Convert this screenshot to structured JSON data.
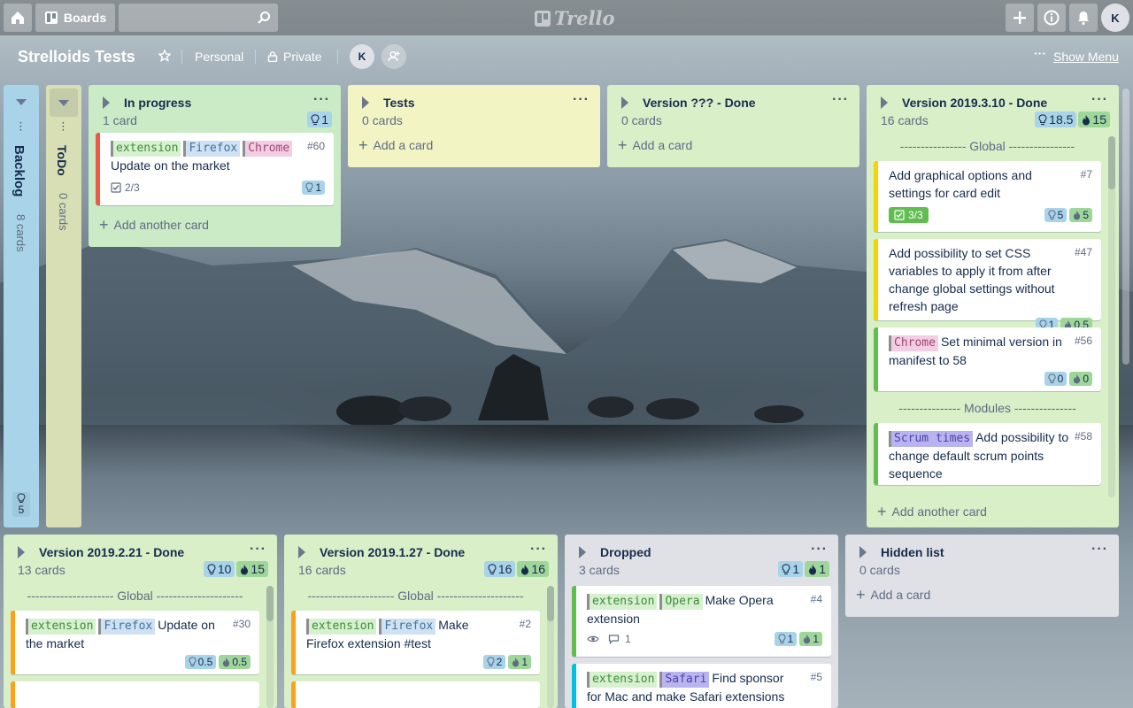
{
  "header": {
    "boards_label": "Boards",
    "logo_text": "Trello",
    "user_initial": "K"
  },
  "board": {
    "title": "Strelloids Tests",
    "team": "Personal",
    "visibility": "Private",
    "member_initial": "K",
    "show_menu": "Show Menu"
  },
  "collapsed": [
    {
      "title": "Backlog",
      "count": "8 cards",
      "points": "5"
    },
    {
      "title": "ToDo",
      "count": "0 cards"
    }
  ],
  "lists": {
    "in_progress": {
      "title": "In progress",
      "count": "1 card",
      "est": "1",
      "cards": [
        {
          "labels": [
            "extension",
            "Firefox",
            "Chrome"
          ],
          "text": "Update on the market",
          "num": "#60",
          "checklist": "2/3",
          "est": "1"
        }
      ],
      "add": "Add another card"
    },
    "tests": {
      "title": "Tests",
      "count": "0 cards",
      "add": "Add a card"
    },
    "version_unknown": {
      "title": "Version ??? - Done",
      "count": "0 cards",
      "add": "Add a card"
    },
    "v2019_3_10": {
      "title": "Version 2019.3.10 - Done",
      "count": "16 cards",
      "est": "18.5",
      "spent": "15",
      "sep_global": "Global",
      "sep_modules": "Modules",
      "cards": [
        {
          "text": "Add graphical options and settings for card edit",
          "num": "#7",
          "checklist": "3/3",
          "est": "5",
          "spent": "5"
        },
        {
          "text": "Add possibility to set CSS variables to apply it from after change global settings without refresh page",
          "num": "#47",
          "est": "1",
          "spent": "0.5"
        },
        {
          "labels": [
            "Chrome"
          ],
          "text": "Set minimal version in manifest to 58",
          "num": "#56",
          "est": "0",
          "spent": "0"
        },
        {
          "labels": [
            "Scrum times"
          ],
          "text": "Add possibility to change default scrum points sequence",
          "num": "#58"
        }
      ],
      "add": "Add another card"
    },
    "v2019_2_21": {
      "title": "Version 2019.2.21 - Done",
      "count": "13 cards",
      "est": "10",
      "spent": "15",
      "sep_global": "Global",
      "cards": [
        {
          "labels": [
            "extension",
            "Firefox"
          ],
          "text": "Update on the market",
          "num": "#30",
          "est": "0.5",
          "spent": "0.5"
        }
      ]
    },
    "v2019_1_27": {
      "title": "Version 2019.1.27 - Done",
      "count": "16 cards",
      "est": "16",
      "spent": "16",
      "sep_global": "Global",
      "cards": [
        {
          "labels": [
            "extension",
            "Firefox"
          ],
          "text": "Make Firefox extension #test",
          "num": "#2",
          "est": "2",
          "spent": "1"
        }
      ]
    },
    "dropped": {
      "title": "Dropped",
      "count": "3 cards",
      "est": "1",
      "spent": "1",
      "cards": [
        {
          "labels": [
            "extension",
            "Opera"
          ],
          "text": "Make Opera extension",
          "num": "#4",
          "comments": "1",
          "est": "1",
          "spent": "1"
        },
        {
          "labels": [
            "extension",
            "Safari"
          ],
          "text": "Find sponsor for Mac and make Safari extensions",
          "num": "#5"
        }
      ]
    },
    "hidden": {
      "title": "Hidden list",
      "count": "0 cards",
      "add": "Add a card"
    }
  },
  "colors": {
    "red": "#eb5a46",
    "yellow": "#f2d600",
    "green": "#61bd4f",
    "orange": "#ff9f1a",
    "sky": "#00c2e0"
  }
}
